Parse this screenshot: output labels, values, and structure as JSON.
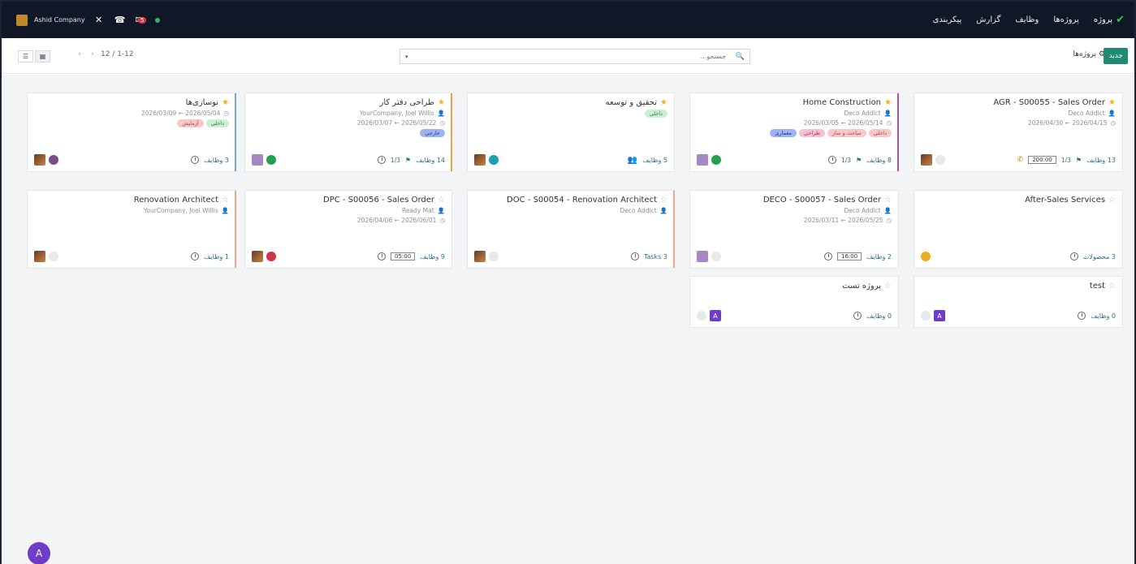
{
  "navbar": {
    "menu": [
      "پروژه",
      "پروژه‌ها",
      "وظایف",
      "گزارش",
      "پیکربندی"
    ],
    "company": "Ashid Company",
    "chat_badge": "5"
  },
  "control": {
    "pager": "12 / 1-12",
    "search_placeholder": "جستجو...",
    "new_label": "جدید",
    "breadcrumb": "پروژه‌ها"
  },
  "cards": [
    {
      "title": "AGR - S00055 - Sales Order",
      "line1": "Deco Addict",
      "dates": "2026/04/15 ← 2026/04/30",
      "starred": true,
      "tasks": "13 وظایف",
      "milestone": "1/3",
      "time": "200:00",
      "tags": []
    },
    {
      "title": "Home Construction",
      "line1": "Deco Addict",
      "dates": "2026/05/14 ← 2026/03/05",
      "starred": true,
      "tasks": "8 وظایف",
      "milestone": "1/3",
      "tags": [
        "داخلی",
        "ساخت و ساز",
        "طراحی",
        "معماری"
      ]
    },
    {
      "title": "تحقیق و توسعه",
      "line1": "",
      "dates": "",
      "starred": true,
      "tasks": "5 وظایف",
      "tags": [
        "داخلی"
      ]
    },
    {
      "title": "طراحی دفتر کار",
      "line1": "YourCompany, Joel Willis",
      "dates": "2026/05/22 ← 2026/03/07",
      "starred": true,
      "tasks": "14 وظایف",
      "milestone": "1/3",
      "tags": [
        "خارجی"
      ]
    },
    {
      "title": "نوسازی‌ها",
      "line1": "",
      "dates": "2026/05/04 ← 2026/03/09",
      "starred": true,
      "tasks": "3 وظایف",
      "tags": [
        "داخلی",
        "آزمایش"
      ]
    },
    {
      "title": "After-Sales Services",
      "line1": "",
      "dates": "",
      "starred": false,
      "tasks": "3 محصولات",
      "tags": []
    },
    {
      "title": "DECO - S00057 - Sales Order",
      "line1": "Deco Addict",
      "dates": "2026/05/25 ← 2026/03/11",
      "starred": false,
      "tasks": "2 وظایف",
      "time": "16:00",
      "tags": []
    },
    {
      "title": "DOC - S00054 - Renovation Architect",
      "line1": "Deco Addict",
      "dates": "",
      "starred": false,
      "tasks": "3 Tasks",
      "tags": []
    },
    {
      "title": "DPC - S00056 - Sales Order",
      "line1": "Ready Mat",
      "dates": "2026/06/01 ← 2026/04/06",
      "starred": false,
      "tasks": "9 وظایف",
      "time": "05:00",
      "tags": []
    },
    {
      "title": "Renovation Architect",
      "line1": "YourCompany, Joel Willis",
      "dates": "",
      "starred": false,
      "tasks": "1 وظایف",
      "tags": []
    },
    {
      "title": "test",
      "line1": "",
      "dates": "",
      "starred": false,
      "tasks": "0 وظایف",
      "tags": []
    },
    {
      "title": "پروژه تست",
      "line1": "",
      "dates": "",
      "starred": false,
      "tasks": "0 وظایف",
      "tags": []
    }
  ],
  "floating_avatar": "A",
  "colors": {
    "primary": "#1f8a73",
    "navbar": "#101726"
  }
}
